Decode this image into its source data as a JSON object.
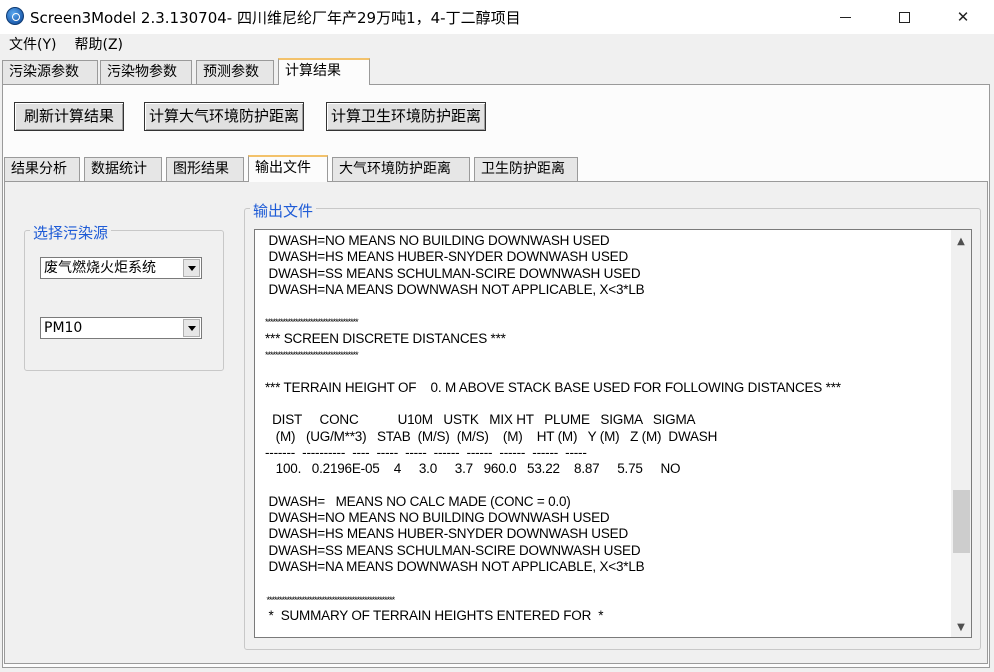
{
  "window": {
    "title": "Screen3Model 2.3.130704- 四川维尼纶厂年产29万吨1，4-丁二醇项目"
  },
  "menu": {
    "items": [
      "文件(Y)",
      "帮助(Z)"
    ]
  },
  "outer_tabs": [
    "污染源参数",
    "污染物参数",
    "预测参数",
    "计算结果"
  ],
  "outer_active": "计算结果",
  "toolbar": {
    "refresh_label": "刷新计算结果",
    "calc_air_label": "计算大气环境防护距离",
    "calc_health_label": "计算卫生环境防护距离"
  },
  "inner_tabs": [
    "结果分析",
    "数据统计",
    "图形结果",
    "输出文件",
    "大气环境防护距离",
    "卫生防护距离"
  ],
  "inner_active": "输出文件",
  "source_group": {
    "legend": "选择污染源",
    "source_value": "废气燃烧火炬系统",
    "pollutant_value": "PM10"
  },
  "output_group": {
    "legend": "输出文件",
    "lines": [
      " DWASH=NO MEANS NO BUILDING DOWNWASH USED",
      " DWASH=HS MEANS HUBER-SNYDER DOWNWASH USED",
      " DWASH=SS MEANS SCHULMAN-SCIRE DOWNWASH USED",
      " DWASH=NA MEANS DOWNWASH NOT APPLICABLE, X<3*LB",
      "",
      "*************************************",
      "*** SCREEN DISCRETE DISTANCES ***",
      "*************************************",
      "",
      "*** TERRAIN HEIGHT OF    0. M ABOVE STACK BASE USED FOR FOLLOWING DISTANCES ***",
      "",
      "  DIST     CONC           U10M   USTK   MIX HT   PLUME   SIGMA   SIGMA",
      "   (M)   (UG/M**3)   STAB  (M/S)  (M/S)    (M)    HT (M)   Y (M)   Z (M)  DWASH",
      "-------  ----------  ----  -----  -----  ------  ------  ------  ------  -----",
      "   100.   0.2196E-05    4     3.0     3.7   960.0   53.22    8.87     5.75     NO",
      "",
      " DWASH=   MEANS NO CALC MADE (CONC = 0.0)",
      " DWASH=NO MEANS NO BUILDING DOWNWASH USED",
      " DWASH=HS MEANS HUBER-SNYDER DOWNWASH USED",
      " DWASH=SS MEANS SCHULMAN-SCIRE DOWNWASH USED",
      " DWASH=NA MEANS DOWNWASH NOT APPLICABLE, X<3*LB",
      "",
      " ***************************************************",
      " *  SUMMARY OF TERRAIN HEIGHTS ENTERED FOR  *"
    ]
  }
}
